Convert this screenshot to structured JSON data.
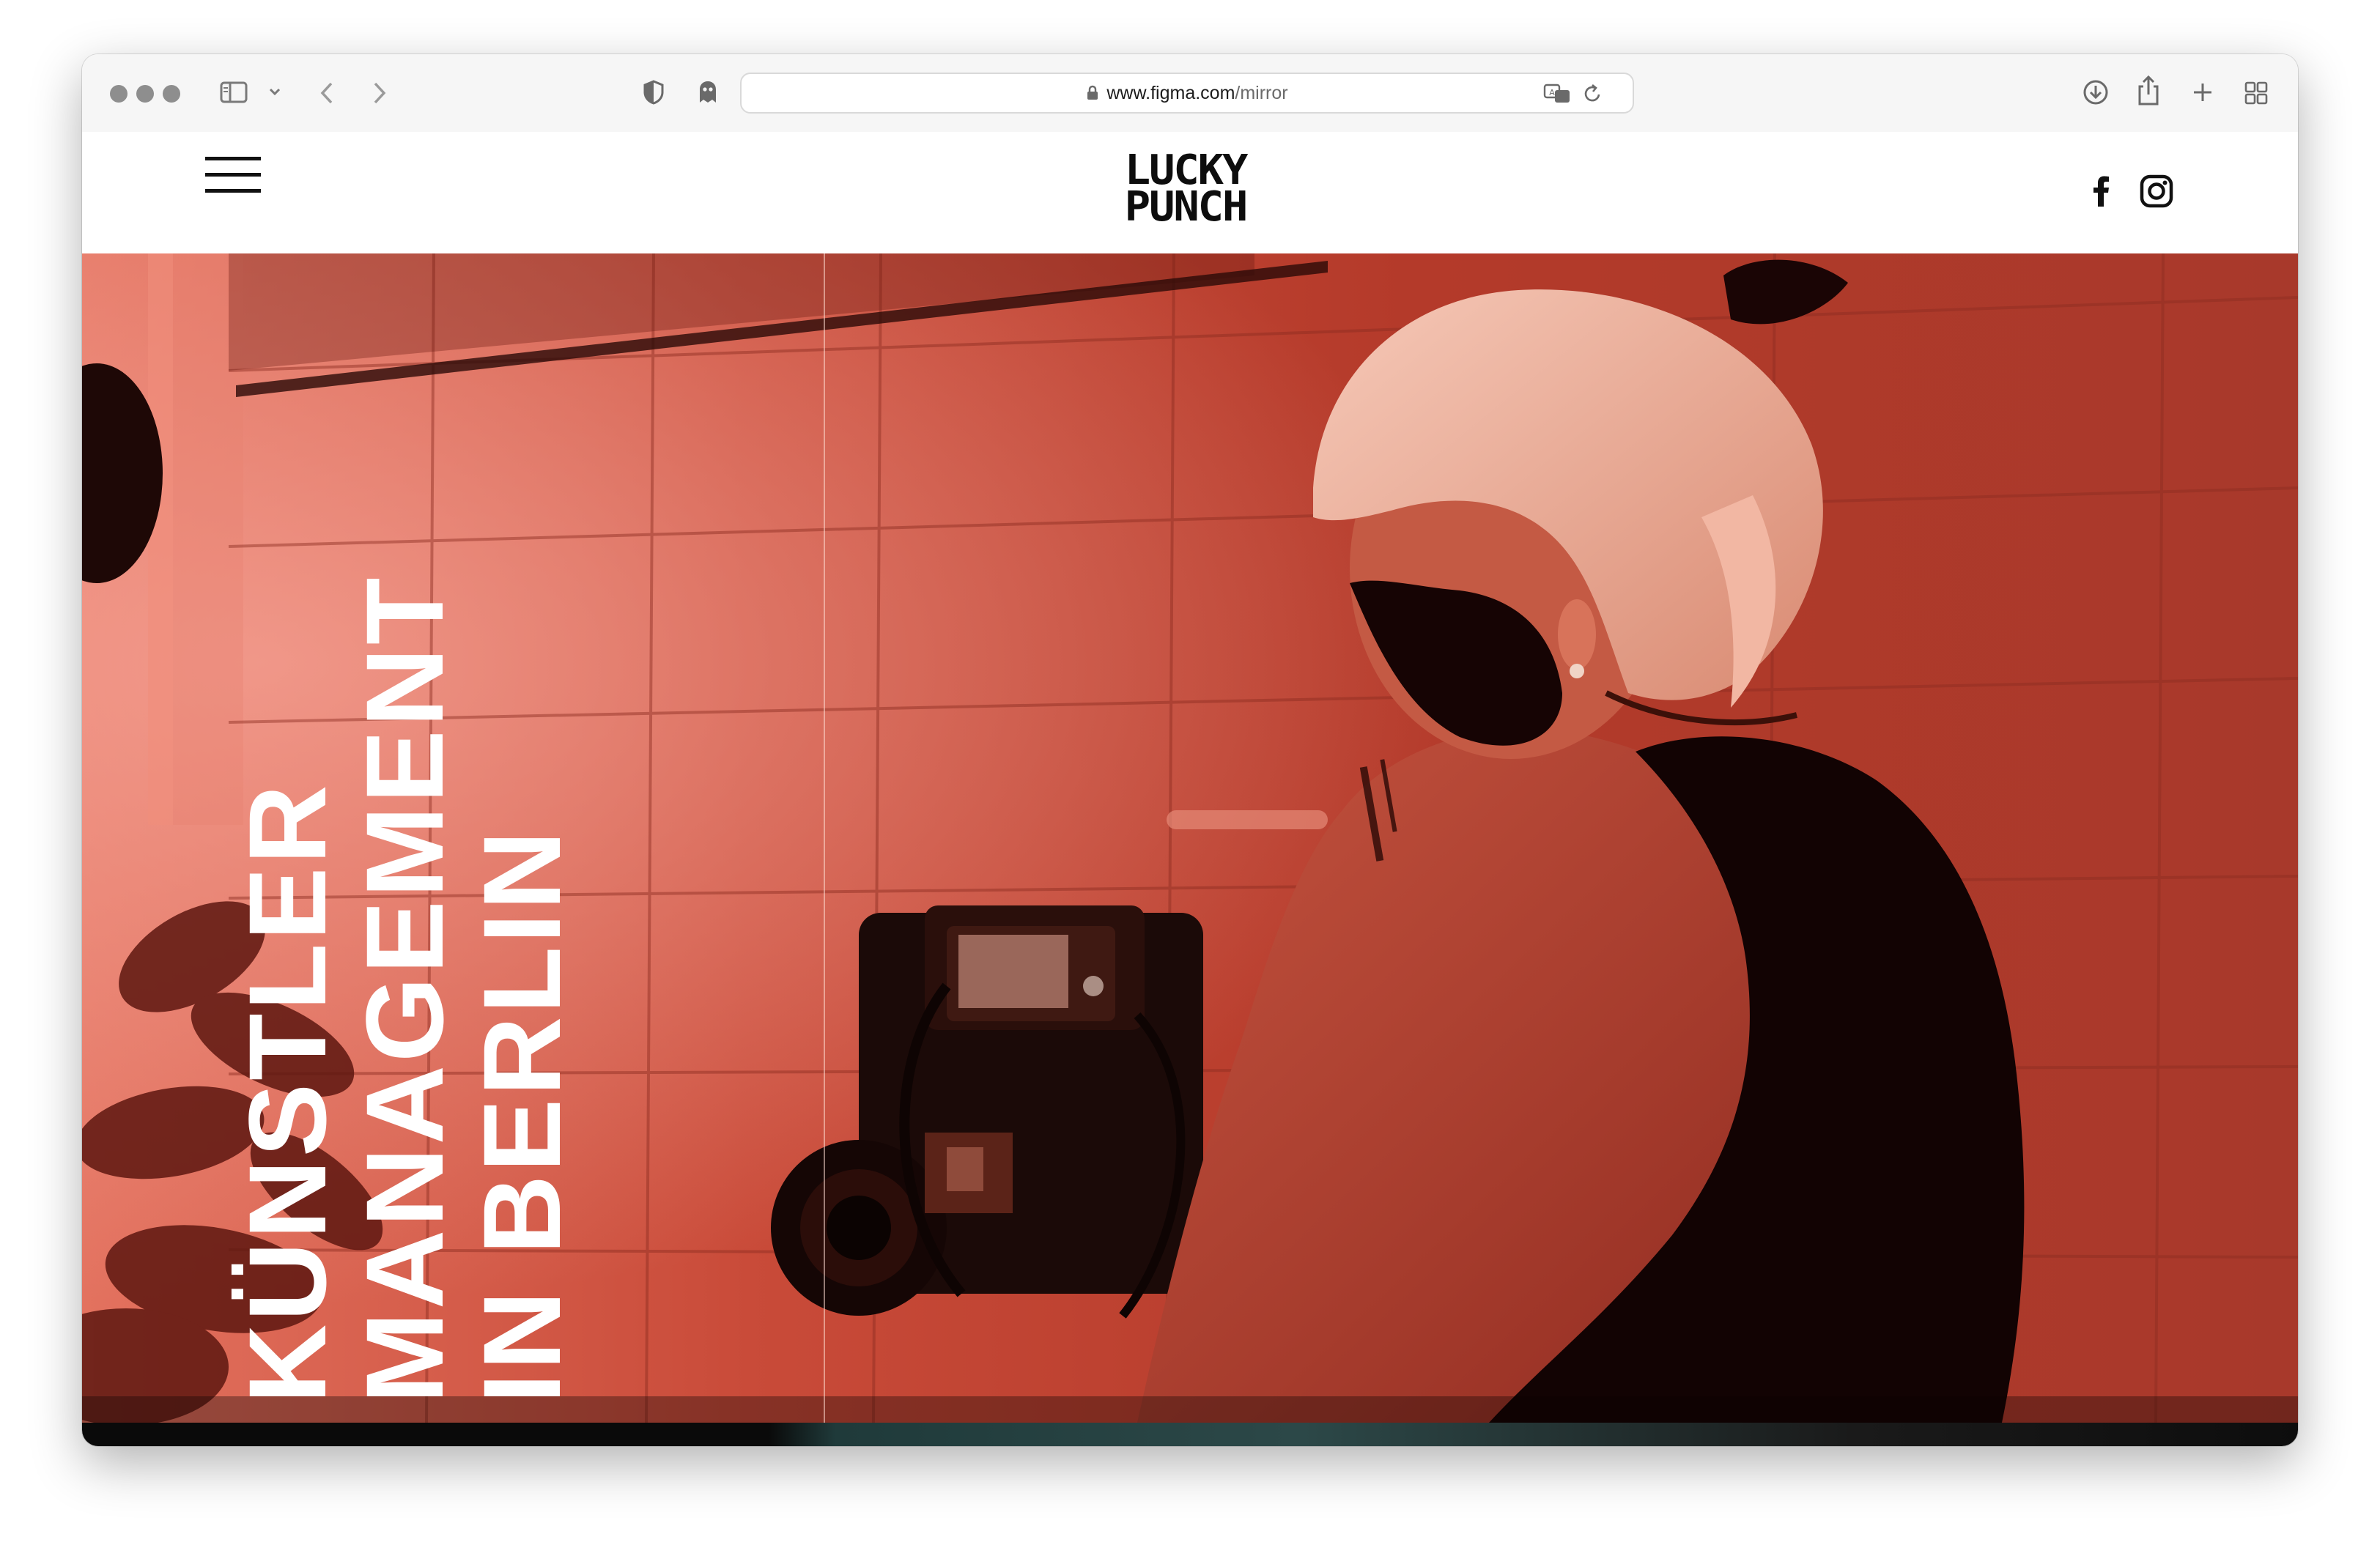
{
  "browser": {
    "url_host": "www.figma.com",
    "url_path": "/mirror"
  },
  "site": {
    "logo_line1": "LUCKY",
    "logo_line2": "PUNCH",
    "social": [
      "facebook",
      "instagram"
    ]
  },
  "hero": {
    "title_lines": [
      "KÜNSTLER",
      "MANAGEMENT",
      "IN BERLIN"
    ]
  },
  "colors": {
    "hero_red": "#b43a2a",
    "hero_light": "#e3725f",
    "header_bg": "#ffffff",
    "text_dark": "#111111"
  }
}
